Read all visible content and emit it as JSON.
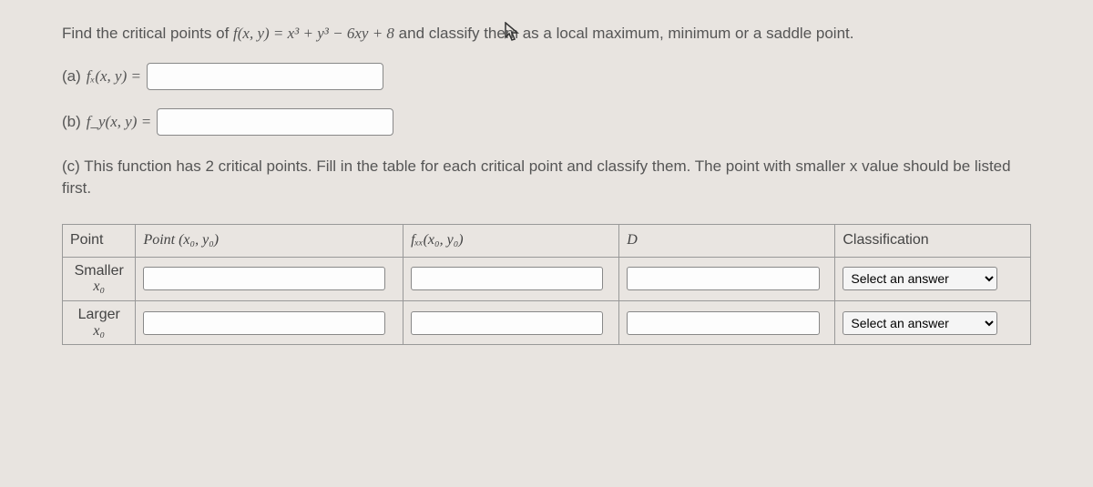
{
  "problem": {
    "intro_pre": "Find the critical points of ",
    "fxy": "f(x, y) = x³ + y³ − 6xy + 8",
    "intro_post": " and classify them as a local maximum, minimum or a saddle point."
  },
  "parts": {
    "a_label": "(a) ",
    "a_math": "fₓ(x, y) = ",
    "b_label": "(b) ",
    "b_math": "f_y(x, y) = ",
    "c_text": "(c) This function has 2 critical points. Fill in the table for each critical point and classify them. The point with smaller x value should be listed first."
  },
  "table": {
    "headers": {
      "point": "Point",
      "coord": "Point (x₀, y₀)",
      "fxx": "fₓₓ(x₀, y₀)",
      "d": "D",
      "classification": "Classification"
    },
    "rows": [
      {
        "label_top": "Smaller",
        "label_bottom": "x₀",
        "select_placeholder": "Select an answer"
      },
      {
        "label_top": "Larger",
        "label_bottom": "x₀",
        "select_placeholder": "Select an answer"
      }
    ]
  }
}
